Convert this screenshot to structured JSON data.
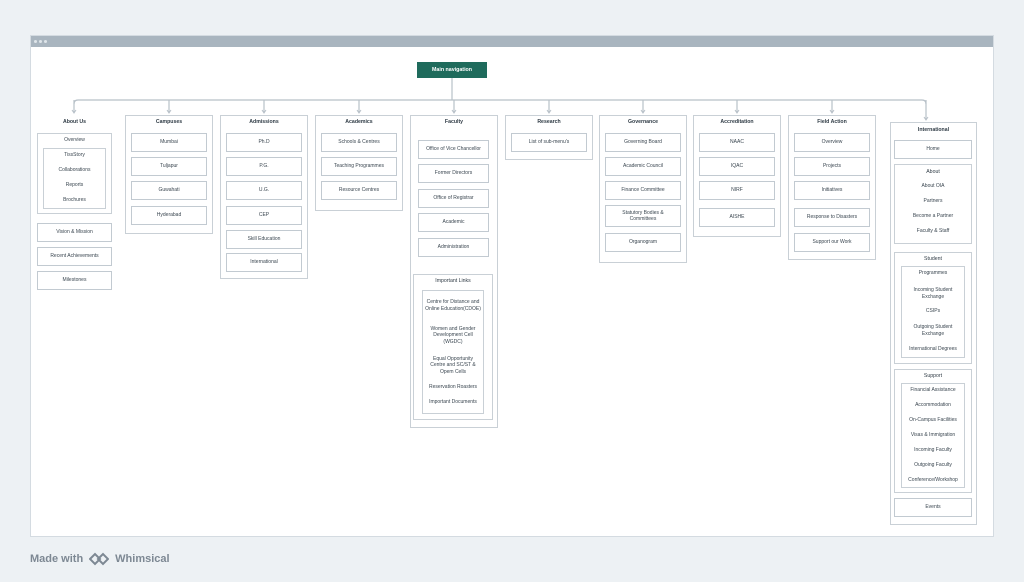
{
  "footer": {
    "made_with": "Made with",
    "brand": "Whimsical"
  },
  "root": {
    "label": "Main navigation"
  },
  "about": {
    "title": "About Us",
    "overview": "Overview",
    "sub": [
      "TissStory",
      "Collaborations",
      "Reports",
      "Brochures"
    ],
    "items": [
      "Vision & Mission",
      "Recent Achievements",
      "Milestones"
    ]
  },
  "campuses": {
    "title": "Campuses",
    "items": [
      "Mumbai",
      "Tuljapur",
      "Guwahati",
      "Hyderabad"
    ]
  },
  "admissions": {
    "title": "Admissions",
    "items": [
      "Ph.D",
      "P.G.",
      "U.G.",
      "CEP",
      "Skill Education",
      "International"
    ]
  },
  "academics": {
    "title": "Academics",
    "items": [
      "Schools & Centres",
      "Teaching Programmes",
      "Resource Centres"
    ]
  },
  "faculty": {
    "title": "Faculty",
    "items": [
      "Office of Vice Chancellor",
      "Former Directors",
      "Office of Registrar",
      "Academic",
      "Administration"
    ],
    "links_title": "Important Links",
    "links": [
      "Centre for Distance and Online Education(CDOE)",
      "Women and Gender Development Cell (WGDC)",
      "Equal Opportunity Centre and SC/ST & Opem Cells",
      "Reservation Roasters",
      "Important Documents"
    ]
  },
  "research": {
    "title": "Research",
    "items": [
      "List of sub-menu's"
    ]
  },
  "governance": {
    "title": "Governance",
    "items": [
      "Governing Board",
      "Academic Council",
      "Finance Committee",
      "Statutory Bodies & Committees",
      "Organogram"
    ]
  },
  "accreditation": {
    "title": "Accreditation",
    "items": [
      "NAAC",
      "IQAC",
      "NIRF",
      "AISHE"
    ]
  },
  "field": {
    "title": "Field Action",
    "items": [
      "Overview",
      "Projects",
      "Initiatives",
      "Response to Disasters",
      "Support our Work"
    ]
  },
  "international": {
    "title": "International",
    "home": "Home",
    "about_title": "About",
    "about": [
      "About OIA",
      "Partners",
      "Become a Partner",
      "Faculty & Staff"
    ],
    "student_title": "Student",
    "student": [
      "Programmes",
      "Incoming Student Exchange",
      "CSIPs",
      "Outgoing Student Exchange",
      "International Degrees"
    ],
    "support_title": "Support",
    "support": [
      "Financial Assistance",
      "Accommodation",
      "On-Campus Facilities",
      "Visas & Immigration",
      "Incoming Faculty",
      "Outgoing Faculty",
      "Conference/Workshop"
    ],
    "events": "Events"
  },
  "colors": {
    "root": "#1f6b5c",
    "connector": "#b7c0c8",
    "titlebar": "#a9b5bf"
  }
}
